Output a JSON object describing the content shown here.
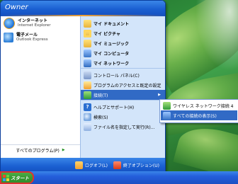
{
  "menu": {
    "user_name": "Owner",
    "pinned": [
      {
        "name": "インターネット",
        "sub": "Internet Explorer",
        "icon": "internet-explorer-icon"
      },
      {
        "name": "電子メール",
        "sub": "Outlook Express",
        "icon": "outlook-express-icon"
      }
    ],
    "all_programs_label": "すべてのプログラム(P)",
    "right_items": [
      {
        "label": "マイ ドキュメント",
        "icon": "my-documents-icon"
      },
      {
        "label": "マイ ピクチャ",
        "icon": "my-pictures-icon"
      },
      {
        "label": "マイ ミュージック",
        "icon": "my-music-icon"
      },
      {
        "label": "マイ コンピュータ",
        "icon": "my-computer-icon"
      },
      {
        "label": "マイ ネットワーク",
        "icon": "my-network-icon"
      },
      {
        "label": "コントロール パネル(C)",
        "icon": "control-panel-icon"
      },
      {
        "label": "プログラムのアクセスと既定の設定",
        "icon": "program-access-icon"
      },
      {
        "label": "接続(T)",
        "icon": "connect-to-icon",
        "selected": true
      },
      {
        "label": "ヘルプとサポート(H)",
        "icon": "help-icon"
      },
      {
        "label": "検索(S)",
        "icon": "search-icon"
      },
      {
        "label": "ファイル名を指定して実行(R)...",
        "icon": "run-icon"
      }
    ],
    "footer": {
      "logoff_label": "ログオフ(L)",
      "shutdown_label": "終了オプション(U)"
    }
  },
  "submenu": {
    "items": [
      {
        "label": "ワイヤレス ネットワーク接続 4",
        "icon": "wireless-connection-icon"
      },
      {
        "label": "すべての接続の表示(S)",
        "icon": "all-connections-icon",
        "selected": true
      }
    ]
  },
  "taskbar": {
    "start_label": "スタート"
  },
  "colors": {
    "header_blue": "#1a5fd1",
    "selection_blue": "#316ac5",
    "start_green": "#3a9a34",
    "highlight_red": "#e03030"
  }
}
